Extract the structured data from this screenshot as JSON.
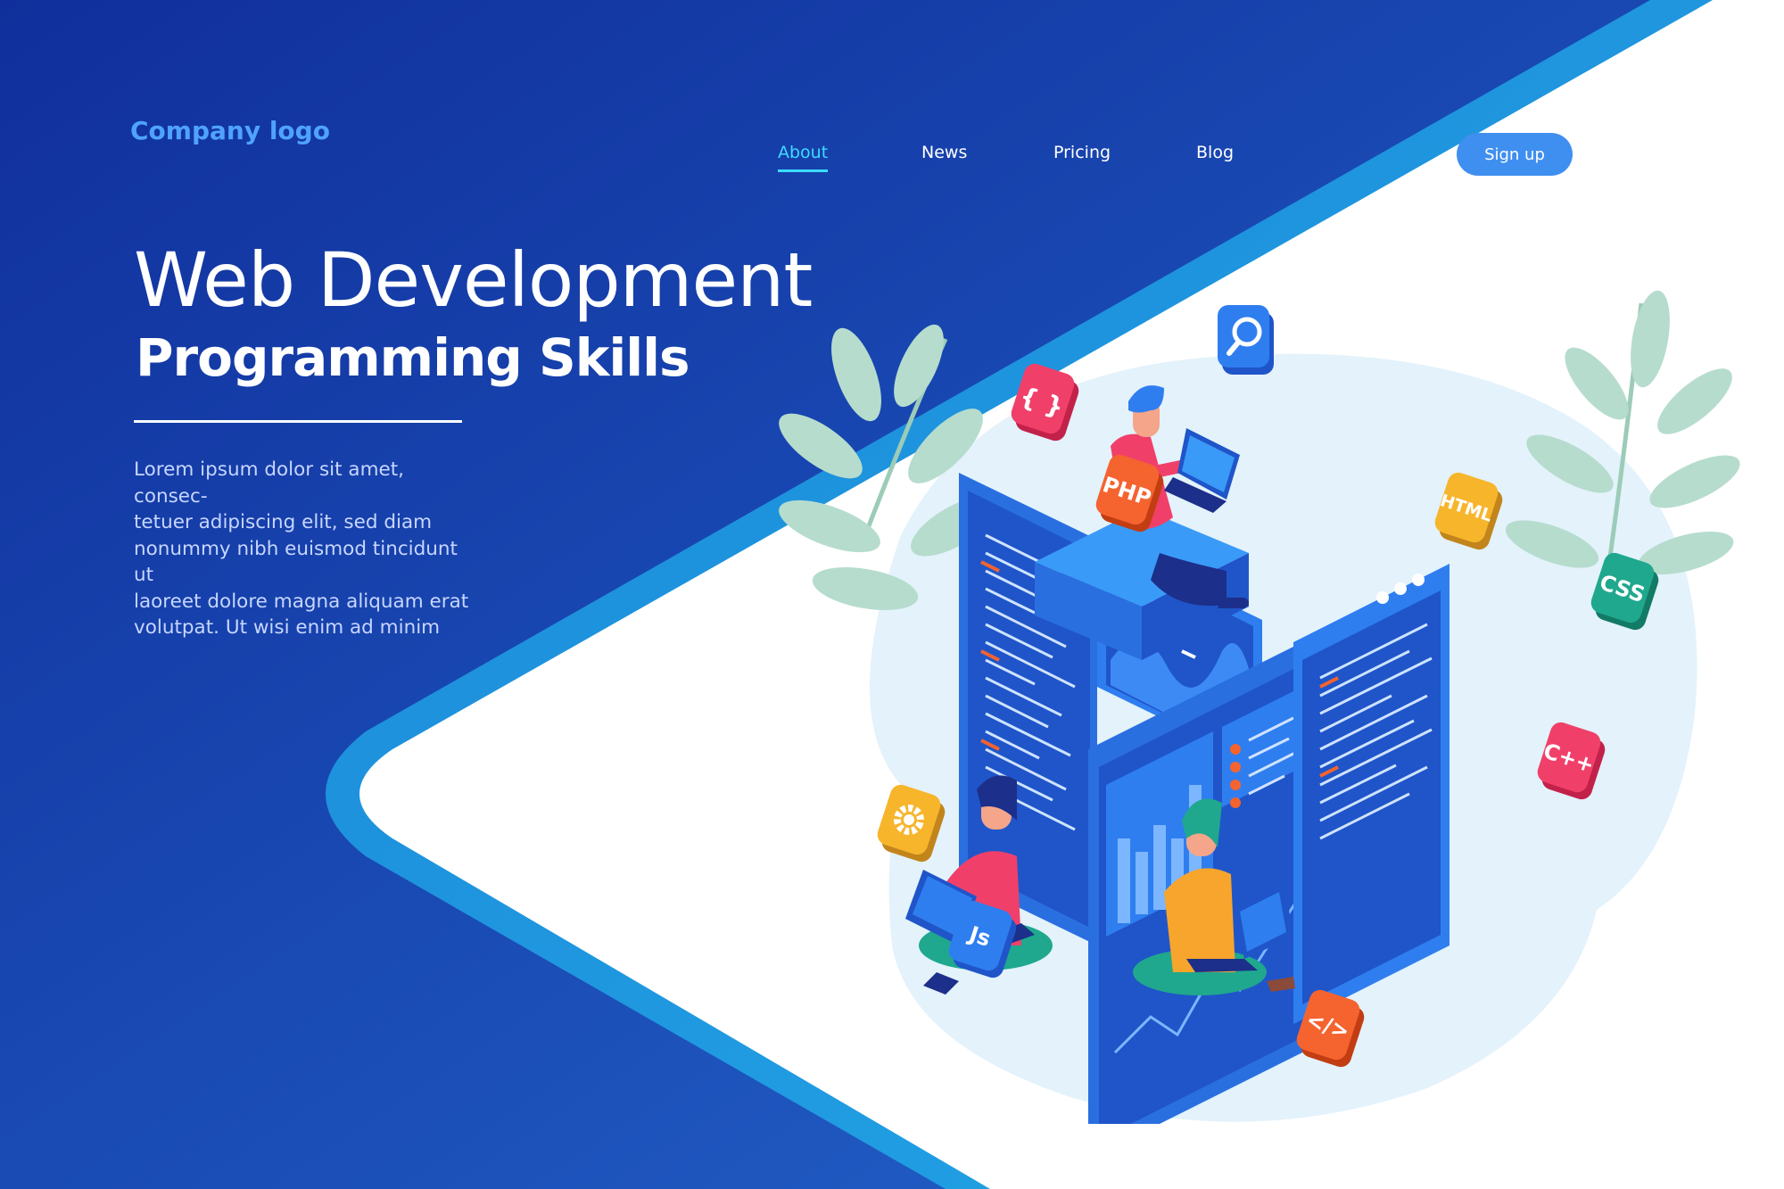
{
  "brand": {
    "logo_text": "Company logo"
  },
  "nav": {
    "items": [
      {
        "label": "About",
        "active": true
      },
      {
        "label": "News"
      },
      {
        "label": "Pricing"
      },
      {
        "label": "Blog"
      }
    ],
    "signup_label": "Sign up"
  },
  "hero": {
    "title": "Web Development",
    "subtitle": "Programming Skills",
    "body_lines": [
      "Lorem ipsum dolor sit amet, consec-",
      "tetuer adipiscing elit, sed diam",
      "nonummy nibh euismod tincidunt ut",
      "laoreet dolore magna aliquam erat",
      "volutpat. Ut wisi enim ad minim"
    ]
  },
  "badges": {
    "braces": "{ }",
    "php": "PHP",
    "html": "HTML",
    "css": "CSS",
    "cpp": "C++",
    "js": "Js",
    "code": "</>"
  },
  "colors": {
    "background_dark": "#102f9c",
    "background_mid": "#1e5ac4",
    "accent": "#3ddcff",
    "button": "#3f8ff0",
    "badge_pink": "#f0406a",
    "badge_orange": "#f5632f",
    "badge_yellow": "#f7b52c",
    "badge_teal": "#1fa88e",
    "badge_blue": "#2f7ef0"
  },
  "icons": [
    "search-icon",
    "gear-icon",
    "curly-braces-icon",
    "code-tag-icon"
  ]
}
